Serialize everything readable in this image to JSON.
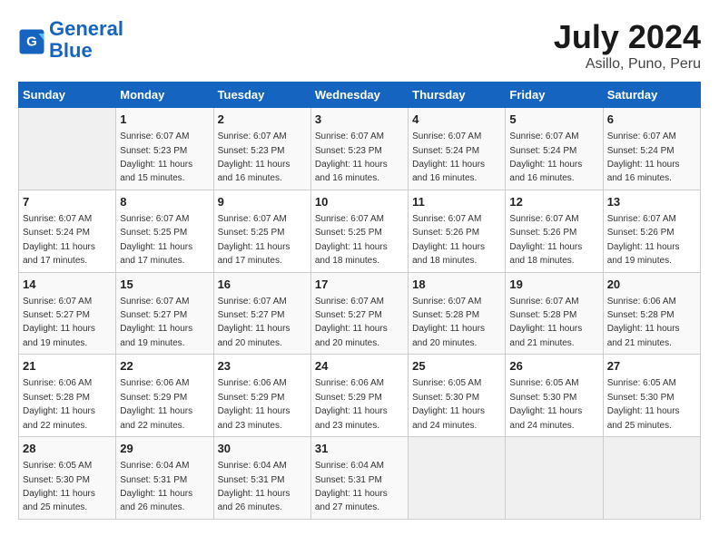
{
  "logo": {
    "line1": "General",
    "line2": "Blue"
  },
  "title": "July 2024",
  "subtitle": "Asillo, Puno, Peru",
  "days_header": [
    "Sunday",
    "Monday",
    "Tuesday",
    "Wednesday",
    "Thursday",
    "Friday",
    "Saturday"
  ],
  "weeks": [
    [
      {
        "day": "",
        "sunrise": "",
        "sunset": "",
        "daylight": ""
      },
      {
        "day": "1",
        "sunrise": "Sunrise: 6:07 AM",
        "sunset": "Sunset: 5:23 PM",
        "daylight": "Daylight: 11 hours and 15 minutes."
      },
      {
        "day": "2",
        "sunrise": "Sunrise: 6:07 AM",
        "sunset": "Sunset: 5:23 PM",
        "daylight": "Daylight: 11 hours and 16 minutes."
      },
      {
        "day": "3",
        "sunrise": "Sunrise: 6:07 AM",
        "sunset": "Sunset: 5:23 PM",
        "daylight": "Daylight: 11 hours and 16 minutes."
      },
      {
        "day": "4",
        "sunrise": "Sunrise: 6:07 AM",
        "sunset": "Sunset: 5:24 PM",
        "daylight": "Daylight: 11 hours and 16 minutes."
      },
      {
        "day": "5",
        "sunrise": "Sunrise: 6:07 AM",
        "sunset": "Sunset: 5:24 PM",
        "daylight": "Daylight: 11 hours and 16 minutes."
      },
      {
        "day": "6",
        "sunrise": "Sunrise: 6:07 AM",
        "sunset": "Sunset: 5:24 PM",
        "daylight": "Daylight: 11 hours and 16 minutes."
      }
    ],
    [
      {
        "day": "7",
        "sunrise": "Sunrise: 6:07 AM",
        "sunset": "Sunset: 5:24 PM",
        "daylight": "Daylight: 11 hours and 17 minutes."
      },
      {
        "day": "8",
        "sunrise": "Sunrise: 6:07 AM",
        "sunset": "Sunset: 5:25 PM",
        "daylight": "Daylight: 11 hours and 17 minutes."
      },
      {
        "day": "9",
        "sunrise": "Sunrise: 6:07 AM",
        "sunset": "Sunset: 5:25 PM",
        "daylight": "Daylight: 11 hours and 17 minutes."
      },
      {
        "day": "10",
        "sunrise": "Sunrise: 6:07 AM",
        "sunset": "Sunset: 5:25 PM",
        "daylight": "Daylight: 11 hours and 18 minutes."
      },
      {
        "day": "11",
        "sunrise": "Sunrise: 6:07 AM",
        "sunset": "Sunset: 5:26 PM",
        "daylight": "Daylight: 11 hours and 18 minutes."
      },
      {
        "day": "12",
        "sunrise": "Sunrise: 6:07 AM",
        "sunset": "Sunset: 5:26 PM",
        "daylight": "Daylight: 11 hours and 18 minutes."
      },
      {
        "day": "13",
        "sunrise": "Sunrise: 6:07 AM",
        "sunset": "Sunset: 5:26 PM",
        "daylight": "Daylight: 11 hours and 19 minutes."
      }
    ],
    [
      {
        "day": "14",
        "sunrise": "Sunrise: 6:07 AM",
        "sunset": "Sunset: 5:27 PM",
        "daylight": "Daylight: 11 hours and 19 minutes."
      },
      {
        "day": "15",
        "sunrise": "Sunrise: 6:07 AM",
        "sunset": "Sunset: 5:27 PM",
        "daylight": "Daylight: 11 hours and 19 minutes."
      },
      {
        "day": "16",
        "sunrise": "Sunrise: 6:07 AM",
        "sunset": "Sunset: 5:27 PM",
        "daylight": "Daylight: 11 hours and 20 minutes."
      },
      {
        "day": "17",
        "sunrise": "Sunrise: 6:07 AM",
        "sunset": "Sunset: 5:27 PM",
        "daylight": "Daylight: 11 hours and 20 minutes."
      },
      {
        "day": "18",
        "sunrise": "Sunrise: 6:07 AM",
        "sunset": "Sunset: 5:28 PM",
        "daylight": "Daylight: 11 hours and 20 minutes."
      },
      {
        "day": "19",
        "sunrise": "Sunrise: 6:07 AM",
        "sunset": "Sunset: 5:28 PM",
        "daylight": "Daylight: 11 hours and 21 minutes."
      },
      {
        "day": "20",
        "sunrise": "Sunrise: 6:06 AM",
        "sunset": "Sunset: 5:28 PM",
        "daylight": "Daylight: 11 hours and 21 minutes."
      }
    ],
    [
      {
        "day": "21",
        "sunrise": "Sunrise: 6:06 AM",
        "sunset": "Sunset: 5:28 PM",
        "daylight": "Daylight: 11 hours and 22 minutes."
      },
      {
        "day": "22",
        "sunrise": "Sunrise: 6:06 AM",
        "sunset": "Sunset: 5:29 PM",
        "daylight": "Daylight: 11 hours and 22 minutes."
      },
      {
        "day": "23",
        "sunrise": "Sunrise: 6:06 AM",
        "sunset": "Sunset: 5:29 PM",
        "daylight": "Daylight: 11 hours and 23 minutes."
      },
      {
        "day": "24",
        "sunrise": "Sunrise: 6:06 AM",
        "sunset": "Sunset: 5:29 PM",
        "daylight": "Daylight: 11 hours and 23 minutes."
      },
      {
        "day": "25",
        "sunrise": "Sunrise: 6:05 AM",
        "sunset": "Sunset: 5:30 PM",
        "daylight": "Daylight: 11 hours and 24 minutes."
      },
      {
        "day": "26",
        "sunrise": "Sunrise: 6:05 AM",
        "sunset": "Sunset: 5:30 PM",
        "daylight": "Daylight: 11 hours and 24 minutes."
      },
      {
        "day": "27",
        "sunrise": "Sunrise: 6:05 AM",
        "sunset": "Sunset: 5:30 PM",
        "daylight": "Daylight: 11 hours and 25 minutes."
      }
    ],
    [
      {
        "day": "28",
        "sunrise": "Sunrise: 6:05 AM",
        "sunset": "Sunset: 5:30 PM",
        "daylight": "Daylight: 11 hours and 25 minutes."
      },
      {
        "day": "29",
        "sunrise": "Sunrise: 6:04 AM",
        "sunset": "Sunset: 5:31 PM",
        "daylight": "Daylight: 11 hours and 26 minutes."
      },
      {
        "day": "30",
        "sunrise": "Sunrise: 6:04 AM",
        "sunset": "Sunset: 5:31 PM",
        "daylight": "Daylight: 11 hours and 26 minutes."
      },
      {
        "day": "31",
        "sunrise": "Sunrise: 6:04 AM",
        "sunset": "Sunset: 5:31 PM",
        "daylight": "Daylight: 11 hours and 27 minutes."
      },
      {
        "day": "",
        "sunrise": "",
        "sunset": "",
        "daylight": ""
      },
      {
        "day": "",
        "sunrise": "",
        "sunset": "",
        "daylight": ""
      },
      {
        "day": "",
        "sunrise": "",
        "sunset": "",
        "daylight": ""
      }
    ]
  ]
}
